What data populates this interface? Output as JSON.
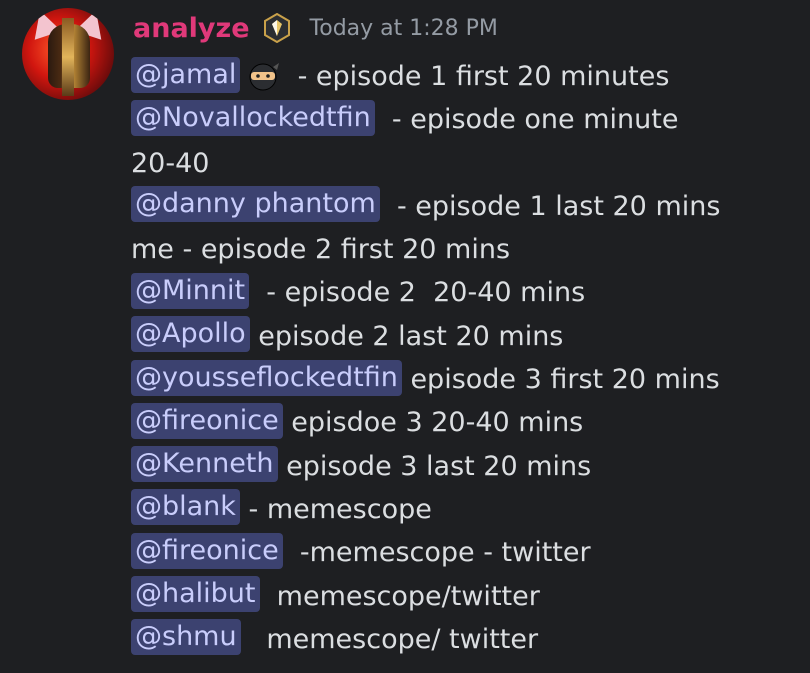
{
  "message": {
    "username": "analyze",
    "timestamp": "Today at 1:28 PM",
    "accent_color": "#e0397a",
    "mention_bg": "#3c4270",
    "badge_icon": "guild-tag-icon",
    "lines": [
      {
        "mention": "@jamal",
        "emoji": "ninja-emoji",
        "text": "  - episode 1 first 20 minutes"
      },
      {
        "mention": "@Novallockedtfin",
        "text": "  - episode one minute"
      },
      {
        "mention": "",
        "text": "20-40"
      },
      {
        "mention": "@danny phantom",
        "text": "  - episode 1 last 20 mins"
      },
      {
        "mention": "",
        "text": "me - episode 2 first 20 mins"
      },
      {
        "mention": "@Minnit",
        "text": "  - episode 2  20-40 mins"
      },
      {
        "mention": "@Apollo",
        "text": " episode 2 last 20 mins"
      },
      {
        "mention": "@yousseflockedtfin",
        "text": " episode 3 first 20 mins"
      },
      {
        "mention": "@fireonice",
        "text": " episdoe 3 20-40 mins"
      },
      {
        "mention": "@Kenneth",
        "text": " episode 3 last 20 mins"
      },
      {
        "mention": "@blank",
        "text": " - memescope"
      },
      {
        "mention": "@fireonice",
        "text": "  -memescope - twitter"
      },
      {
        "mention": "@halibut",
        "text": "  memescope/twitter"
      },
      {
        "mention": "@shmu",
        "text": "   memescope/ twitter"
      }
    ]
  }
}
